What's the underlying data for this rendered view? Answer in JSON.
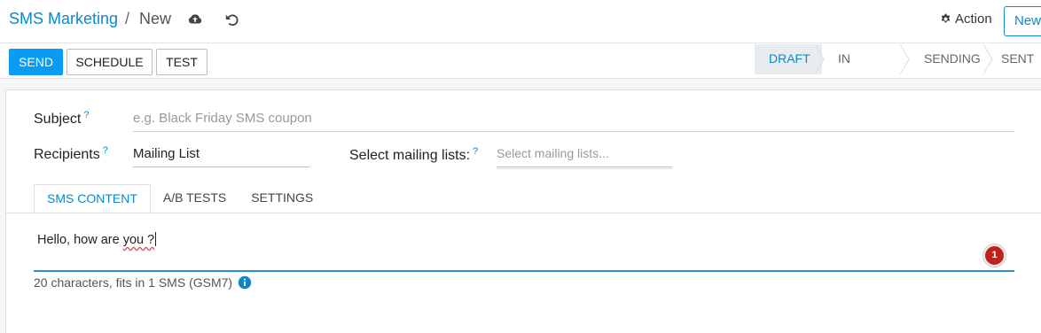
{
  "breadcrumb": {
    "parent": "SMS Marketing",
    "separator": "/",
    "current": "New"
  },
  "header": {
    "action_label": "Action",
    "new_label": "New"
  },
  "toolbar": {
    "send": "SEND",
    "schedule": "SCHEDULE",
    "test": "TEST"
  },
  "status_bar": {
    "stages": [
      "DRAFT",
      "IN QUEUE",
      "SENDING",
      "SENT"
    ],
    "active": "DRAFT"
  },
  "form": {
    "subject_label": "Subject",
    "subject_help": "?",
    "subject_placeholder": "e.g. Black Friday SMS coupon",
    "recipients_label": "Recipients",
    "recipients_help": "?",
    "recipients_value": "Mailing List",
    "mailing_lists_label": "Select mailing lists:",
    "mailing_lists_help": "?",
    "mailing_lists_placeholder": "Select mailing lists..."
  },
  "tabs": [
    "SMS CONTENT",
    "A/B TESTS",
    "SETTINGS"
  ],
  "content": {
    "text_start": "Hello, how are ",
    "text_misspelled": "you ?",
    "badge_count": "1",
    "counter_text": "20 characters, fits in 1 SMS (GSM7)"
  },
  "colors": {
    "accent": "#0c88c8",
    "primary_button": "#0a9bf5",
    "badge": "#c0221b"
  },
  "icons": {
    "save": "cloud-upload-icon",
    "discard": "undo-icon",
    "action": "gear-icon",
    "info": "info-circle-icon"
  }
}
